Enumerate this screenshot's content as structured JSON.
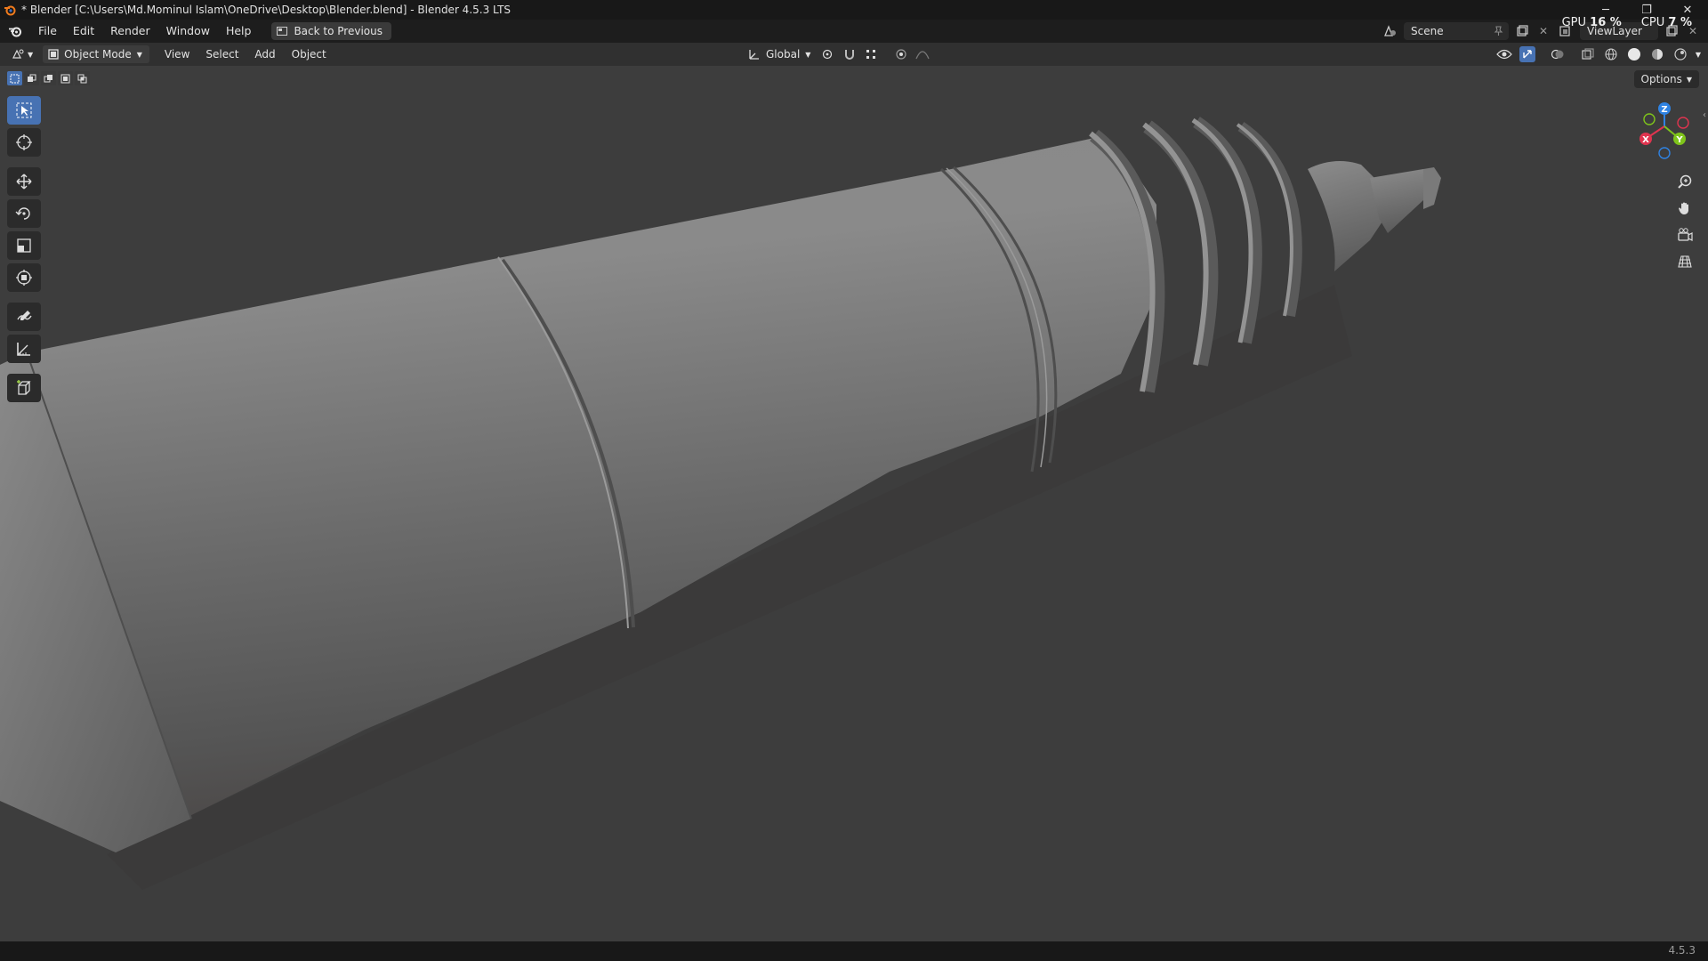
{
  "window": {
    "title": "* Blender [C:\\Users\\Md.Mominul Islam\\OneDrive\\Desktop\\Blender.blend] - Blender 4.5.3 LTS",
    "minimize": "─",
    "restore": "❐",
    "close": "✕"
  },
  "menubar": {
    "items": [
      "File",
      "Edit",
      "Render",
      "Window",
      "Help"
    ],
    "back_button": "Back to Previous",
    "scene": "Scene",
    "view_layer": "ViewLayer"
  },
  "performance": {
    "gpu_label": "GPU",
    "gpu_value": "16 %",
    "cpu_label": "CPU",
    "cpu_value": "7 %"
  },
  "header": {
    "mode": "Object Mode",
    "menus": [
      "View",
      "Select",
      "Add",
      "Object"
    ],
    "transform_orientation": "Global"
  },
  "viewport": {
    "options": "Options",
    "gizmo": {
      "x": "X",
      "y": "Y",
      "z": "Z"
    }
  },
  "status": {
    "version": "4.5.3"
  },
  "colors": {
    "accent": "#4772b3",
    "gizmo_x": "#e0344f",
    "gizmo_y": "#7fc41b",
    "gizmo_z": "#2f83e3",
    "viewport_bg": "#3d3d3d"
  }
}
